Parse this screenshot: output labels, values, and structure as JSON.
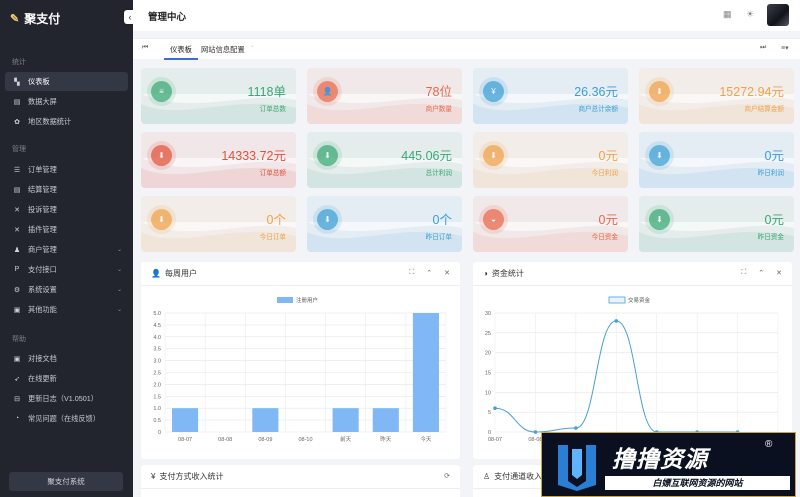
{
  "sidebar": {
    "brand": "聚支付",
    "sections": [
      {
        "title": "统计",
        "items": [
          {
            "label": "仪表板",
            "icon": "dashboard-icon",
            "active": true
          },
          {
            "label": "数据大屏",
            "icon": "screen-icon"
          },
          {
            "label": "地区数据统计",
            "icon": "region-icon"
          }
        ]
      },
      {
        "title": "管理",
        "items": [
          {
            "label": "订单管理",
            "icon": "order-icon"
          },
          {
            "label": "结算管理",
            "icon": "settle-icon"
          },
          {
            "label": "投诉管理",
            "icon": "complaint-icon"
          },
          {
            "label": "插件管理",
            "icon": "plugin-icon"
          },
          {
            "label": "商户管理",
            "icon": "merchant-icon"
          },
          {
            "label": "支付接口",
            "icon": "pay-icon"
          },
          {
            "label": "系统设置",
            "icon": "settings-icon"
          },
          {
            "label": "其他功能",
            "icon": "other-icon"
          }
        ]
      },
      {
        "title": "帮助",
        "items": [
          {
            "label": "对接文档",
            "icon": "doc-icon"
          },
          {
            "label": "在线更新",
            "icon": "update-icon"
          },
          {
            "label": "更新日志（V1.0501）",
            "icon": "log-icon"
          },
          {
            "label": "常见问题（在线反馈）",
            "icon": "faq-icon"
          }
        ]
      }
    ],
    "footer": "聚支付系统"
  },
  "header": {
    "title": "管理中心"
  },
  "tabs": {
    "active": "仪表板",
    "second": "网站信息配置"
  },
  "stats": [
    {
      "value": "1118单",
      "label": "订单总数",
      "color": "#3aa876"
    },
    {
      "value": "78位",
      "label": "商户数量",
      "color": "#e8684a"
    },
    {
      "value": "26.36元",
      "label": "商户总计余额",
      "color": "#3b9fd4"
    },
    {
      "value": "15272.94元",
      "label": "商户结算金额",
      "color": "#f0a24a"
    },
    {
      "value": "14333.72元",
      "label": "订单总额",
      "color": "#e2523a"
    },
    {
      "value": "445.06元",
      "label": "总计利润",
      "color": "#3aa876"
    },
    {
      "value": "0元",
      "label": "今日利润",
      "color": "#f0a24a"
    },
    {
      "value": "0元",
      "label": "昨日利润",
      "color": "#3b9fd4"
    },
    {
      "value": "0个",
      "label": "今日订单",
      "color": "#f0a24a"
    },
    {
      "value": "0个",
      "label": "昨日订单",
      "color": "#3b9fd4"
    },
    {
      "value": "0元",
      "label": "今日资金",
      "color": "#e8684a"
    },
    {
      "value": "0元",
      "label": "昨日资金",
      "color": "#3aa876"
    }
  ],
  "panels": {
    "weekly_users": "每周用户",
    "funds": "资金统计",
    "pay_method": "支付方式收入统计",
    "channel": "支付通道收入"
  },
  "chart_data": [
    {
      "type": "bar",
      "categories": [
        "08-07",
        "08-08",
        "08-09",
        "08-10",
        "前天",
        "昨天",
        "今天"
      ],
      "series": [
        {
          "name": "注册用户",
          "values": [
            1,
            0,
            1,
            0,
            1,
            1,
            5
          ]
        }
      ],
      "ylim": [
        0,
        5
      ],
      "yticks": [
        "0",
        "0.5",
        "1.0",
        "1.5",
        "2.0",
        "2.5",
        "3.0",
        "3.5",
        "4.0",
        "4.5",
        "5.0"
      ],
      "color": "#7fb8f5",
      "legend": "top-center",
      "grid": true
    },
    {
      "type": "line",
      "categories": [
        "08-07",
        "08-08",
        "08-09",
        "08-10",
        "前天",
        "昨天",
        "今天"
      ],
      "series": [
        {
          "name": "交易资金",
          "values": [
            6,
            0,
            1,
            28,
            0,
            0,
            0
          ]
        }
      ],
      "ylim": [
        0,
        30
      ],
      "yticks": [
        "0",
        "5",
        "10",
        "15",
        "20",
        "25",
        "30"
      ],
      "color": "#4a9fd6",
      "legend": "top-center",
      "grid": true
    }
  ],
  "watermark": {
    "title": "撸撸资源",
    "reg": "®",
    "subtitle": "白嫖互联网资源的网站"
  }
}
